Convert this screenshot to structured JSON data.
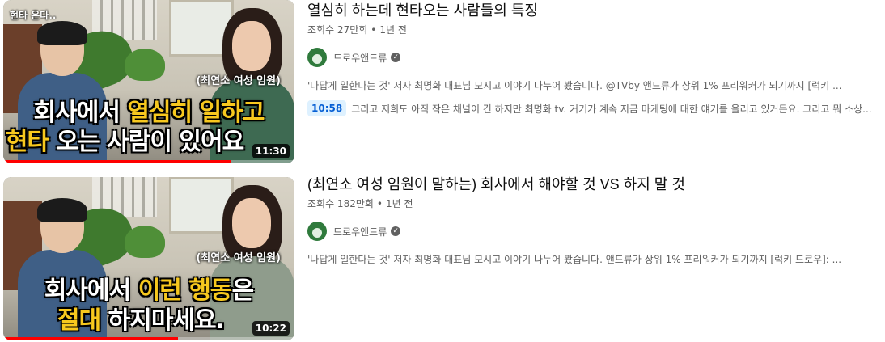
{
  "results": [
    {
      "title": "열심히 하는데 현타오는 사람들의 특징",
      "views": "조회수 27만회",
      "age": "1년 전",
      "channel": "드로우앤드류",
      "description": "'나답게 일한다는 것' 저자 최명화 대표님 모시고 이야기 나누어 봤습니다. @TVby 앤드류가 상위 1% 프리워커가 되기까지 [럭키 ...",
      "chapter_time": "10:58",
      "chapter_text": "그리고 저희도 아직 작은 채널이 긴 하지만 최명화 tv. 거기가 계속 지금 마케팅에 대한 얘기를 올리고 있거든요. 그리고 뭐 소상...",
      "duration": "11:30",
      "progress": 0.78,
      "thumb": {
        "tag": "현타 온다..",
        "caption": "(최연소 여성 임원)",
        "line1_pre": "회사에서 ",
        "line1_hl": "열심히 일하고",
        "line1_post": "",
        "line2_pre": "",
        "line2_hl": "현타",
        "line2_post": " 오는 사람이 있어요"
      }
    },
    {
      "title": "(최연소 여성 임원이 말하는) 회사에서 해야할 것 VS 하지 말 것",
      "views": "조회수 182만회",
      "age": "1년 전",
      "channel": "드로우앤드류",
      "description": "'나답게 일한다는 것' 저자 최명화 대표님 모시고 이야기 나누어 봤습니다. 앤드류가 상위 1% 프리워커가 되기까지 [럭키 드로우]: ...",
      "duration": "10:22",
      "progress": 0.6,
      "thumb": {
        "tag": "",
        "caption": "(최연소 여성 임원)",
        "line1_pre": "회사에서 ",
        "line1_hl": "이런 행동",
        "line1_post": "은",
        "line2_pre": "",
        "line2_hl": "절대",
        "line2_post": " 하지마세요."
      }
    }
  ],
  "separator": "•",
  "verified_glyph": "✓",
  "colors": {
    "highlight": "#f7c81e",
    "progress": "#ff0000",
    "chip_bg": "#def1ff",
    "chip_text": "#065fd4"
  }
}
